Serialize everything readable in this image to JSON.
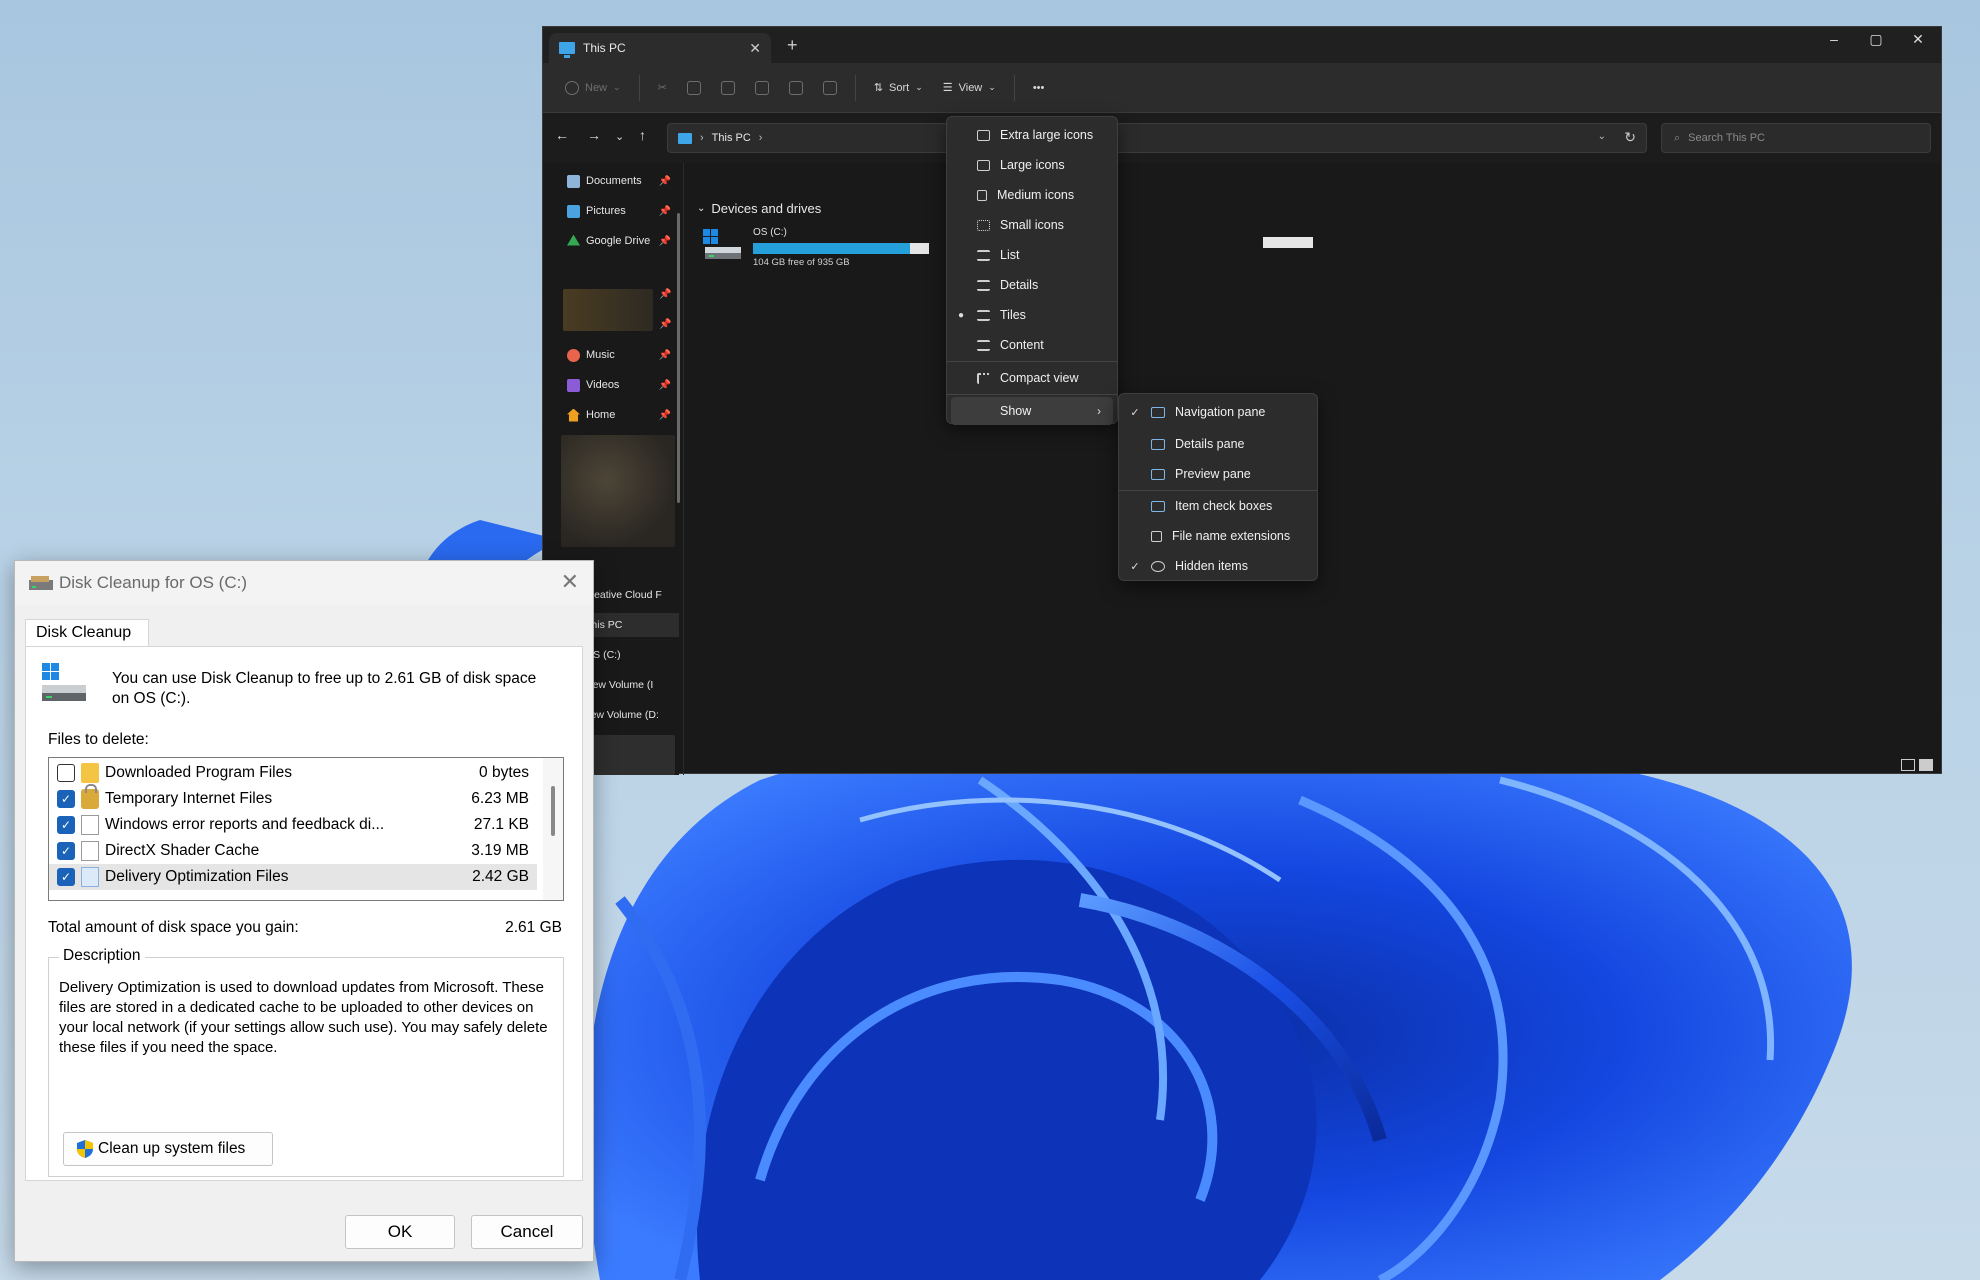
{
  "explorer": {
    "tab_title": "This PC",
    "tab_close": "✕",
    "new_tab": "+",
    "window_controls": {
      "minimize": "–",
      "maximize": "▢",
      "close": "✕"
    },
    "toolbar": {
      "new_label": "New",
      "sort_label": "Sort",
      "view_label": "View",
      "more_label": "•••"
    },
    "address": {
      "crumb": "This PC",
      "search_placeholder": "Search This PC"
    },
    "nav_items": [
      {
        "label": "Documents",
        "icon": "documents-icon",
        "color": "#8fb4d9"
      },
      {
        "label": "Pictures",
        "icon": "pictures-icon",
        "color": "#4aa3df"
      },
      {
        "label": "Google Drive",
        "icon": "google-drive-icon",
        "color": "#34a853"
      },
      {
        "label": "Music",
        "icon": "music-icon",
        "color": "#e8644a"
      },
      {
        "label": "Videos",
        "icon": "videos-icon",
        "color": "#8b5cd6"
      },
      {
        "label": "Home",
        "icon": "home-icon",
        "color": "#f0a020"
      }
    ],
    "nav_lower_items": [
      "Creative Cloud F",
      "This PC",
      "OS (C:)",
      "New Volume (I",
      "New Volume (D:"
    ],
    "group_header": "Devices and drives",
    "drive": {
      "name": "OS (C:)",
      "free_text": "104 GB free of 935 GB",
      "used_fraction": 0.89
    }
  },
  "view_menu": {
    "items": [
      {
        "label": "Extra large icons",
        "selected": false
      },
      {
        "label": "Large icons",
        "selected": false
      },
      {
        "label": "Medium icons",
        "selected": false
      },
      {
        "label": "Small icons",
        "selected": false
      },
      {
        "label": "List",
        "selected": false
      },
      {
        "label": "Details",
        "selected": false
      },
      {
        "label": "Tiles",
        "selected": true
      },
      {
        "label": "Content",
        "selected": false
      }
    ],
    "compact_view": "Compact view",
    "show": "Show"
  },
  "show_menu": {
    "items": [
      {
        "label": "Navigation pane",
        "checked": true
      },
      {
        "label": "Details pane",
        "checked": false
      },
      {
        "label": "Preview pane",
        "checked": false
      },
      {
        "label": "Item check boxes",
        "checked": false
      },
      {
        "label": "File name extensions",
        "checked": false
      },
      {
        "label": "Hidden items",
        "checked": true
      }
    ]
  },
  "disk_cleanup": {
    "title": "Disk Cleanup for OS (C:)",
    "tab": "Disk Cleanup",
    "intro": "You can use Disk Cleanup to free up to 2.61 GB of disk space on OS (C:).",
    "files_label": "Files to delete:",
    "files": [
      {
        "name": "Downloaded Program Files",
        "size": "0 bytes",
        "checked": false,
        "icon": "folder"
      },
      {
        "name": "Temporary Internet Files",
        "size": "6.23 MB",
        "checked": true,
        "icon": "lock"
      },
      {
        "name": "Windows error reports and feedback di...",
        "size": "27.1 KB",
        "checked": true,
        "icon": "file"
      },
      {
        "name": "DirectX Shader Cache",
        "size": "3.19 MB",
        "checked": true,
        "icon": "file"
      },
      {
        "name": "Delivery Optimization Files",
        "size": "2.42 GB",
        "checked": true,
        "icon": "file blue"
      }
    ],
    "total_label": "Total amount of disk space you gain:",
    "total_value": "2.61 GB",
    "description_label": "Description",
    "description": "Delivery Optimization is used to download updates from Microsoft. These files are stored in a dedicated cache to be uploaded to other devices on your local network (if your settings allow such use). You may safely delete these files if you need the space.",
    "cleanup_system_button": "Clean up system files",
    "ok": "OK",
    "cancel": "Cancel"
  }
}
